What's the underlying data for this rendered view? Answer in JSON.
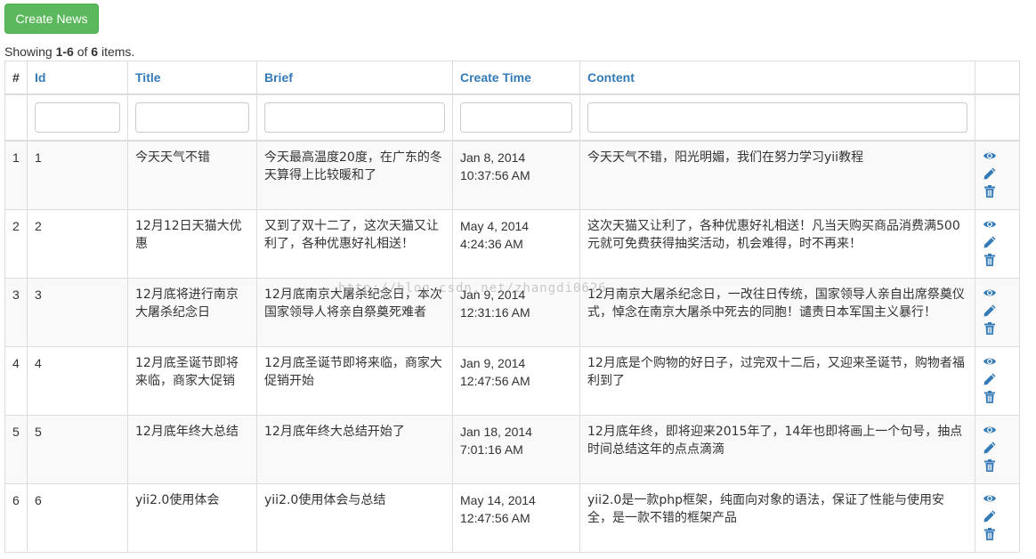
{
  "toolbar": {
    "create_label": "Create News"
  },
  "summary": {
    "prefix": "Showing ",
    "range": "1-6",
    "mid": " of ",
    "total": "6",
    "suffix": " items."
  },
  "columns": {
    "serial": "#",
    "id": "Id",
    "title": "Title",
    "brief": "Brief",
    "create_time": "Create Time",
    "content": "Content"
  },
  "filters": {
    "id": "",
    "title": "",
    "brief": "",
    "create_time": "",
    "content": ""
  },
  "rows": [
    {
      "serial": "1",
      "id": "1",
      "title": "今天天气不错",
      "brief": "今天最高温度20度，在广东的冬天算得上比较暖和了",
      "date": "Jan 8, 2014",
      "time": "10:37:56 AM",
      "content": "今天天气不错，阳光明媚，我们在努力学习yii教程"
    },
    {
      "serial": "2",
      "id": "2",
      "title": "12月12日天猫大优惠",
      "brief": "又到了双十二了，这次天猫又让利了，各种优惠好礼相送！",
      "date": "May 4, 2014",
      "time": "4:24:36 AM",
      "content": "这次天猫又让利了，各种优惠好礼相送！凡当天购买商品消费满500元就可免费获得抽奖活动，机会难得，时不再来！"
    },
    {
      "serial": "3",
      "id": "3",
      "title": "12月底将进行南京大屠杀纪念日",
      "brief": "12月底南京大屠杀纪念日，本次国家领导人将亲自祭奠死难者",
      "date": "Jan 9, 2014",
      "time": "12:31:16 AM",
      "content": "12月南京大屠杀纪念日，一改往日传统，国家领导人亲自出席祭奠仪式，悼念在南京大屠杀中死去的同胞！谴责日本军国主义暴行！"
    },
    {
      "serial": "4",
      "id": "4",
      "title": "12月底圣诞节即将来临，商家大促销",
      "brief": "12月底圣诞节即将来临，商家大促销开始",
      "date": "Jan 9, 2014",
      "time": "12:47:56 AM",
      "content": "12月底是个购物的好日子，过完双十二后，又迎来圣诞节，购物者福利到了"
    },
    {
      "serial": "5",
      "id": "5",
      "title": "12月底年终大总结",
      "brief": "12月底年终大总结开始了",
      "date": "Jan 18, 2014",
      "time": "7:01:16 AM",
      "content": "12月底年终，即将迎来2015年了，14年也即将画上一个句号，抽点时间总结这年的点点滴滴"
    },
    {
      "serial": "6",
      "id": "6",
      "title": "yii2.0使用体会",
      "brief": "yii2.0使用体会与总结",
      "date": "May 14, 2014",
      "time": "12:47:56 AM",
      "content": "yii2.0是一款php框架，纯面向对象的语法，保证了性能与使用安全，是一款不错的框架产品"
    }
  ],
  "row_actions": [
    "eye-icon",
    "pencil-icon",
    "trash-icon"
  ],
  "watermark": "http://blog.csdn.net/zhangdi0626",
  "colors": {
    "create_button": "#5cb85c",
    "link": "#337ab7",
    "action_icon": "#337ab7",
    "stripe": "#f9f9f9",
    "border": "#dddddd"
  }
}
